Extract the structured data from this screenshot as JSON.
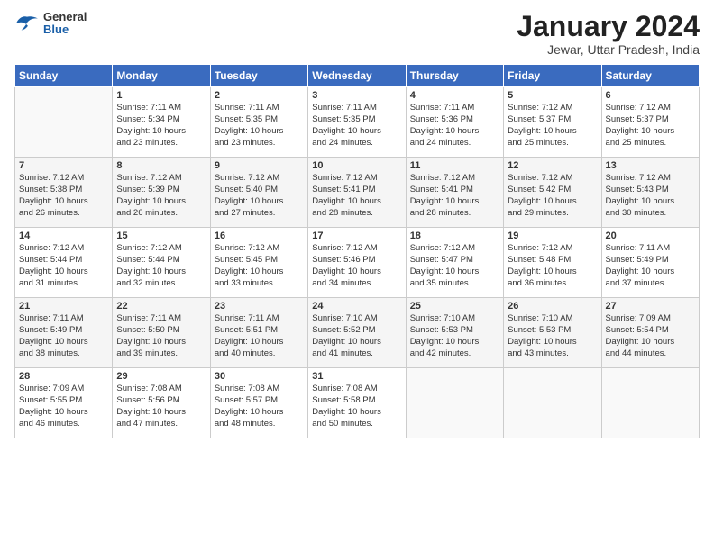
{
  "header": {
    "logo_general": "General",
    "logo_blue": "Blue",
    "month_title": "January 2024",
    "location": "Jewar, Uttar Pradesh, India"
  },
  "days_of_week": [
    "Sunday",
    "Monday",
    "Tuesday",
    "Wednesday",
    "Thursday",
    "Friday",
    "Saturday"
  ],
  "weeks": [
    [
      {
        "day": "",
        "info": ""
      },
      {
        "day": "1",
        "info": "Sunrise: 7:11 AM\nSunset: 5:34 PM\nDaylight: 10 hours\nand 23 minutes."
      },
      {
        "day": "2",
        "info": "Sunrise: 7:11 AM\nSunset: 5:35 PM\nDaylight: 10 hours\nand 23 minutes."
      },
      {
        "day": "3",
        "info": "Sunrise: 7:11 AM\nSunset: 5:35 PM\nDaylight: 10 hours\nand 24 minutes."
      },
      {
        "day": "4",
        "info": "Sunrise: 7:11 AM\nSunset: 5:36 PM\nDaylight: 10 hours\nand 24 minutes."
      },
      {
        "day": "5",
        "info": "Sunrise: 7:12 AM\nSunset: 5:37 PM\nDaylight: 10 hours\nand 25 minutes."
      },
      {
        "day": "6",
        "info": "Sunrise: 7:12 AM\nSunset: 5:37 PM\nDaylight: 10 hours\nand 25 minutes."
      }
    ],
    [
      {
        "day": "7",
        "info": "Sunrise: 7:12 AM\nSunset: 5:38 PM\nDaylight: 10 hours\nand 26 minutes."
      },
      {
        "day": "8",
        "info": "Sunrise: 7:12 AM\nSunset: 5:39 PM\nDaylight: 10 hours\nand 26 minutes."
      },
      {
        "day": "9",
        "info": "Sunrise: 7:12 AM\nSunset: 5:40 PM\nDaylight: 10 hours\nand 27 minutes."
      },
      {
        "day": "10",
        "info": "Sunrise: 7:12 AM\nSunset: 5:41 PM\nDaylight: 10 hours\nand 28 minutes."
      },
      {
        "day": "11",
        "info": "Sunrise: 7:12 AM\nSunset: 5:41 PM\nDaylight: 10 hours\nand 28 minutes."
      },
      {
        "day": "12",
        "info": "Sunrise: 7:12 AM\nSunset: 5:42 PM\nDaylight: 10 hours\nand 29 minutes."
      },
      {
        "day": "13",
        "info": "Sunrise: 7:12 AM\nSunset: 5:43 PM\nDaylight: 10 hours\nand 30 minutes."
      }
    ],
    [
      {
        "day": "14",
        "info": "Sunrise: 7:12 AM\nSunset: 5:44 PM\nDaylight: 10 hours\nand 31 minutes."
      },
      {
        "day": "15",
        "info": "Sunrise: 7:12 AM\nSunset: 5:44 PM\nDaylight: 10 hours\nand 32 minutes."
      },
      {
        "day": "16",
        "info": "Sunrise: 7:12 AM\nSunset: 5:45 PM\nDaylight: 10 hours\nand 33 minutes."
      },
      {
        "day": "17",
        "info": "Sunrise: 7:12 AM\nSunset: 5:46 PM\nDaylight: 10 hours\nand 34 minutes."
      },
      {
        "day": "18",
        "info": "Sunrise: 7:12 AM\nSunset: 5:47 PM\nDaylight: 10 hours\nand 35 minutes."
      },
      {
        "day": "19",
        "info": "Sunrise: 7:12 AM\nSunset: 5:48 PM\nDaylight: 10 hours\nand 36 minutes."
      },
      {
        "day": "20",
        "info": "Sunrise: 7:11 AM\nSunset: 5:49 PM\nDaylight: 10 hours\nand 37 minutes."
      }
    ],
    [
      {
        "day": "21",
        "info": "Sunrise: 7:11 AM\nSunset: 5:49 PM\nDaylight: 10 hours\nand 38 minutes."
      },
      {
        "day": "22",
        "info": "Sunrise: 7:11 AM\nSunset: 5:50 PM\nDaylight: 10 hours\nand 39 minutes."
      },
      {
        "day": "23",
        "info": "Sunrise: 7:11 AM\nSunset: 5:51 PM\nDaylight: 10 hours\nand 40 minutes."
      },
      {
        "day": "24",
        "info": "Sunrise: 7:10 AM\nSunset: 5:52 PM\nDaylight: 10 hours\nand 41 minutes."
      },
      {
        "day": "25",
        "info": "Sunrise: 7:10 AM\nSunset: 5:53 PM\nDaylight: 10 hours\nand 42 minutes."
      },
      {
        "day": "26",
        "info": "Sunrise: 7:10 AM\nSunset: 5:53 PM\nDaylight: 10 hours\nand 43 minutes."
      },
      {
        "day": "27",
        "info": "Sunrise: 7:09 AM\nSunset: 5:54 PM\nDaylight: 10 hours\nand 44 minutes."
      }
    ],
    [
      {
        "day": "28",
        "info": "Sunrise: 7:09 AM\nSunset: 5:55 PM\nDaylight: 10 hours\nand 46 minutes."
      },
      {
        "day": "29",
        "info": "Sunrise: 7:08 AM\nSunset: 5:56 PM\nDaylight: 10 hours\nand 47 minutes."
      },
      {
        "day": "30",
        "info": "Sunrise: 7:08 AM\nSunset: 5:57 PM\nDaylight: 10 hours\nand 48 minutes."
      },
      {
        "day": "31",
        "info": "Sunrise: 7:08 AM\nSunset: 5:58 PM\nDaylight: 10 hours\nand 50 minutes."
      },
      {
        "day": "",
        "info": ""
      },
      {
        "day": "",
        "info": ""
      },
      {
        "day": "",
        "info": ""
      }
    ]
  ]
}
